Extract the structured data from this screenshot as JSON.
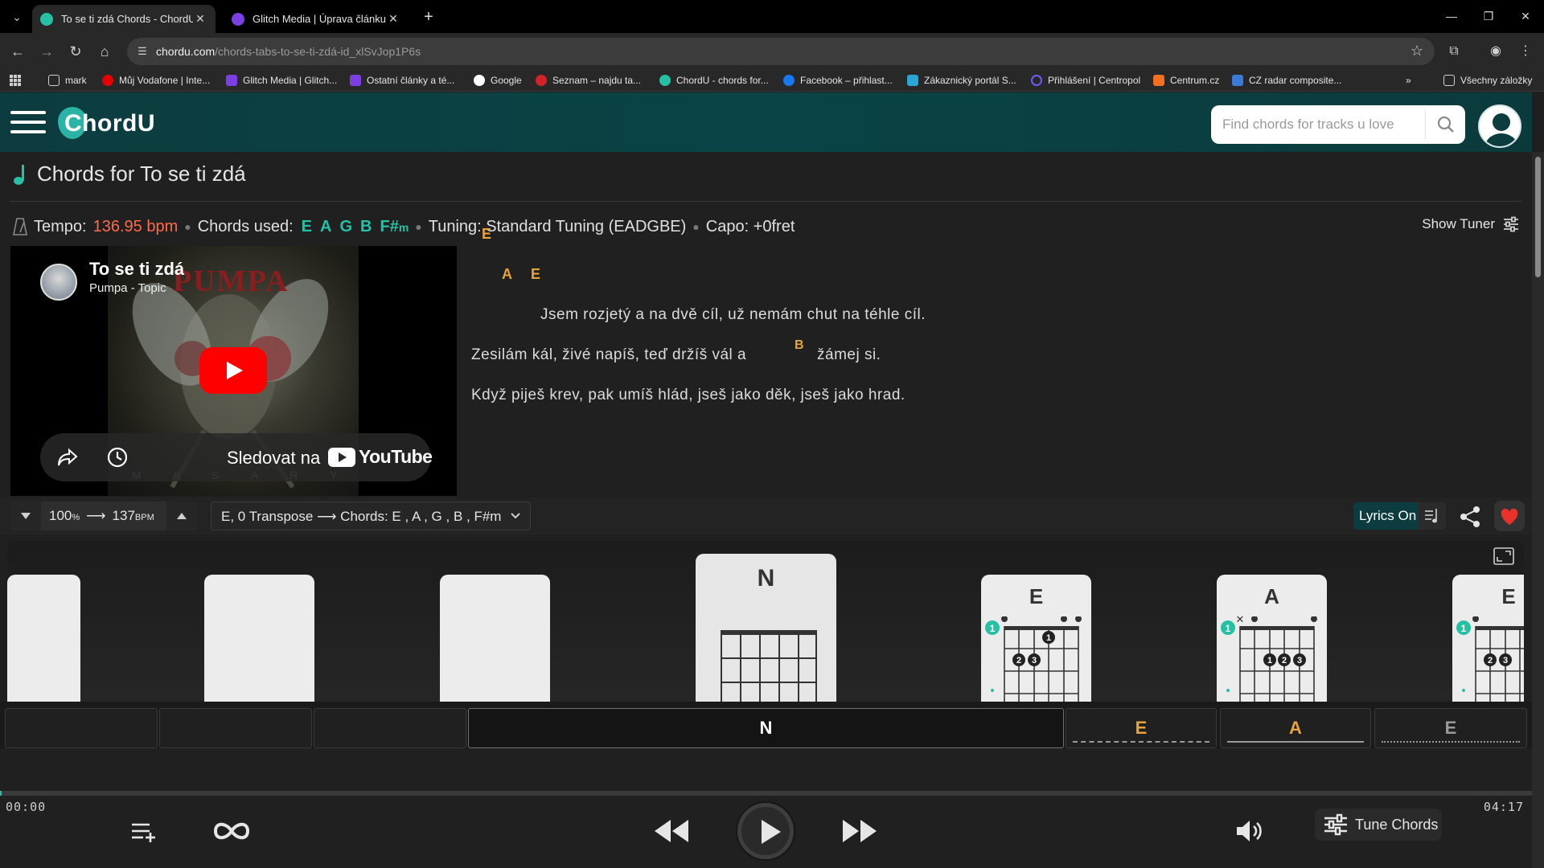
{
  "browser": {
    "tabs": [
      {
        "title": "To se ti zdá Chords - ChordU",
        "active": true
      },
      {
        "title": "Glitch Media | Úprava článku",
        "active": false
      }
    ],
    "url_host": "chordu.com",
    "url_path": "/chords-tabs-to-se-ti-zdá-id_xlSvJop1P6s",
    "bookmarks": [
      "mark",
      "Můj Vodafone | Inte...",
      "Glitch Media | Glitch...",
      "Ostatní články a té...",
      "Google",
      "Seznam – najdu ta...",
      "ChordU - chords for...",
      "Facebook – přihlast...",
      "Zákaznický portál S...",
      "Přihlášení | Centropol",
      "Centrum.cz",
      "CZ radar composite...",
      "Všechny záložky"
    ]
  },
  "site": {
    "logo": "ChordU",
    "search_placeholder": "Find chords for tracks u love"
  },
  "song": {
    "page_title": "Chords for To se ti zdá",
    "tempo_label": "Tempo:",
    "tempo_value": "136.95 bpm",
    "chords_used_label": "Chords used:",
    "chords_used": [
      "E",
      "A",
      "G",
      "B"
    ],
    "chord_last_root": "F#",
    "chord_last_suffix": "m",
    "tuning": "Tuning: Standard Tuning (EADGBE)",
    "capo": "Capo: +0fret",
    "show_tuner": "Show Tuner"
  },
  "video": {
    "title": "To se ti zdá",
    "channel": "Pumpa - Topic",
    "band_art_text": "PUMPA",
    "watch_on": "Sledovat na",
    "youtube": "YouTube"
  },
  "lyrics": {
    "chord_line_1": "E",
    "chord_line_2a": "A",
    "chord_line_2b": "E",
    "line_1": "Jsem rozjetý a na dvě  cíl, už nemám chut na  téhle cíl.",
    "line_2a": "Zesilám kál, živé  napíš, teď držíš vál a",
    "inline_chord": "B",
    "line_2b": "žámej si.",
    "line_3": "Když piješ krev, pak  umíš hlád, jseš jako děk, jseš  jako hrad."
  },
  "controls": {
    "speed_pct": "100",
    "speed_pct_unit": "%",
    "bpm_value": "137",
    "bpm_unit": "BPM",
    "transpose": "E, 0 Transpose ⟶ Chords: E , A , G , B , F#m",
    "lyrics_toggle": "Lyrics On"
  },
  "diagram": {
    "cards": [
      "N",
      "E",
      "A",
      "E"
    ]
  },
  "timeline": {
    "current": "N",
    "upcoming": [
      "E",
      "A",
      "E"
    ]
  },
  "player": {
    "time_elapsed": "00:00",
    "time_total": "04:17",
    "progress_fraction": 0.001,
    "tune_chords": "Tune Chords"
  },
  "colors": {
    "accent": "#26c1a5",
    "chord_orange": "#e8a43a",
    "tempo_red": "#ff6b4a",
    "header_teal": "#0c3c3f"
  }
}
